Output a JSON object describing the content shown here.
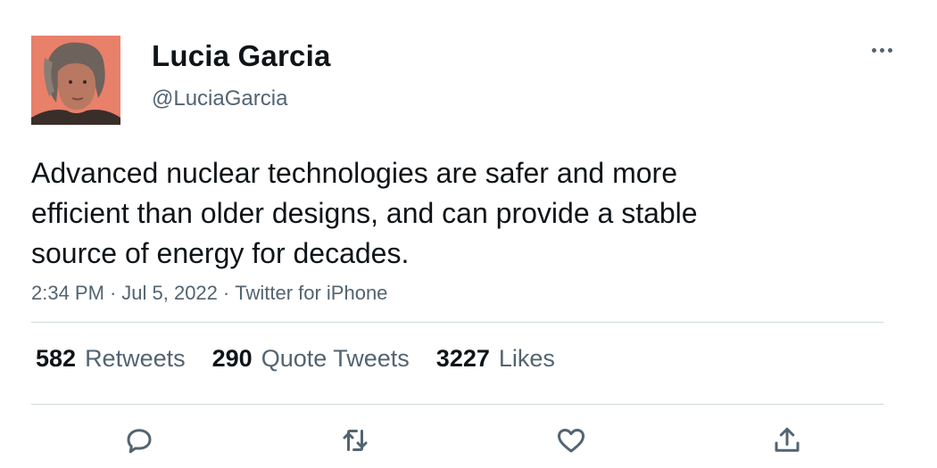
{
  "author": {
    "name": "Lucia Garcia",
    "handle": "@LuciaGarcia",
    "avatar_icon": "profile-photo"
  },
  "tweet": {
    "text": "Advanced nuclear technologies are safer and more\nefficient than older designs, and can provide a stable\nsource of energy for decades.",
    "time": "2:34 PM",
    "date": "Jul 5, 2022",
    "source": "Twitter for iPhone",
    "separator": "·"
  },
  "stats": {
    "retweets_count": "582",
    "retweets_label": "Retweets",
    "quotes_count": "290",
    "quotes_label": "Quote Tweets",
    "likes_count": "3227",
    "likes_label": "Likes"
  },
  "actions": [
    "reply-icon",
    "retweet-icon",
    "like-icon",
    "share-icon"
  ],
  "colors": {
    "text_primary": "#0f1419",
    "text_secondary": "#536471",
    "divider": "#cfd9de",
    "avatar_bg": "#e8806a"
  }
}
